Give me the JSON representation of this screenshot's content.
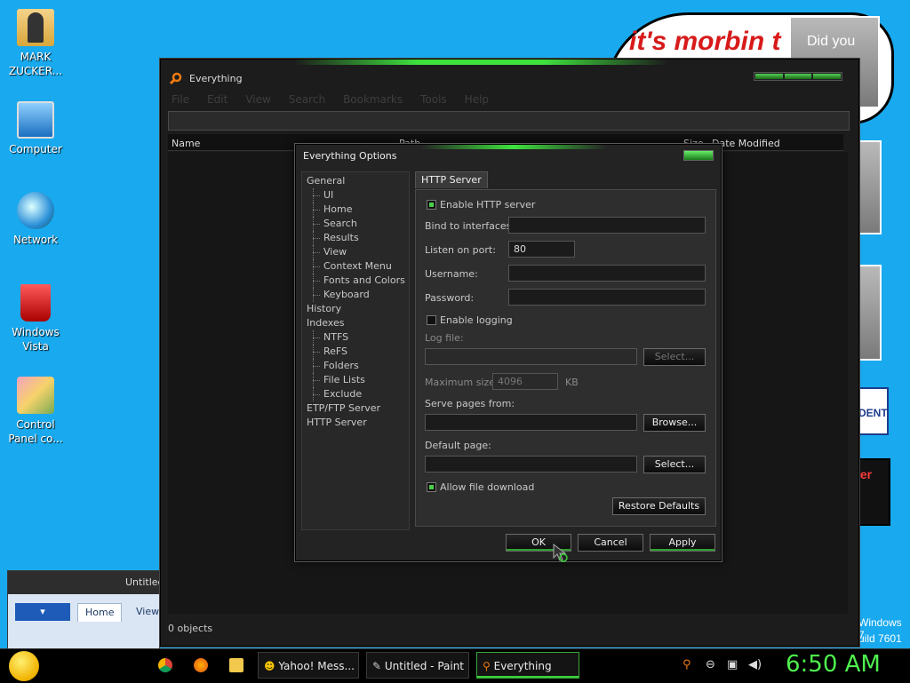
{
  "desktop": {
    "icons": [
      {
        "label": "MARK ZUCKER...",
        "icon": "folder-person-icon"
      },
      {
        "label": "Computer",
        "icon": "computer-icon"
      },
      {
        "label": "Network",
        "icon": "network-icon"
      },
      {
        "label": "Windows Vista",
        "icon": "recycle-bin-icon"
      },
      {
        "label": "Control Panel co...",
        "icon": "control-panel-icon"
      }
    ],
    "wallpaper_text": "it's morbin t",
    "photo_caption": "Did you",
    "dent_text": "DENT",
    "red_box_text": "ier",
    "watermark_line1": "Windows 7",
    "watermark_line2": "uild 7601"
  },
  "paint_window": {
    "title": "Untitled",
    "file_button": "▾",
    "tabs": [
      "Home",
      "View"
    ]
  },
  "everything_window": {
    "title": "Everything",
    "menu": [
      "File",
      "Edit",
      "View",
      "Search",
      "Bookmarks",
      "Tools",
      "Help"
    ],
    "columns": [
      "Name",
      "Path",
      "Size",
      "Date Modified"
    ],
    "status": "0 objects"
  },
  "options_dialog": {
    "title": "Everything Options",
    "tree": [
      {
        "label": "General",
        "level": 1
      },
      {
        "label": "UI",
        "level": 2
      },
      {
        "label": "Home",
        "level": 2
      },
      {
        "label": "Search",
        "level": 2
      },
      {
        "label": "Results",
        "level": 2
      },
      {
        "label": "View",
        "level": 2
      },
      {
        "label": "Context Menu",
        "level": 2
      },
      {
        "label": "Fonts and Colors",
        "level": 2
      },
      {
        "label": "Keyboard",
        "level": 2
      },
      {
        "label": "History",
        "level": 1
      },
      {
        "label": "Indexes",
        "level": 1
      },
      {
        "label": "NTFS",
        "level": 2
      },
      {
        "label": "ReFS",
        "level": 2
      },
      {
        "label": "Folders",
        "level": 2
      },
      {
        "label": "File Lists",
        "level": 2
      },
      {
        "label": "Exclude",
        "level": 2
      },
      {
        "label": "ETP/FTP Server",
        "level": 1
      },
      {
        "label": "HTTP Server",
        "level": 1
      }
    ],
    "tab": "HTTP Server",
    "enable_http": {
      "label": "Enable HTTP server",
      "checked": true
    },
    "bind_label": "Bind to interfaces:",
    "bind_value": "",
    "port_label": "Listen on port:",
    "port_value": "80",
    "username_label": "Username:",
    "username_value": "",
    "password_label": "Password:",
    "password_value": "",
    "enable_logging": {
      "label": "Enable logging",
      "checked": false
    },
    "log_file_label": "Log file:",
    "log_file_value": "",
    "select_button": "Select...",
    "max_size_label": "Maximum size:",
    "max_size_value": "4096",
    "max_size_unit": "KB",
    "serve_label": "Serve pages from:",
    "serve_value": "",
    "browse_button": "Browse...",
    "default_page_label": "Default page:",
    "default_page_value": "",
    "select_button2": "Select...",
    "allow_download": {
      "label": "Allow file download",
      "checked": true
    },
    "restore_button": "Restore Defaults",
    "ok_button": "OK",
    "cancel_button": "Cancel",
    "apply_button": "Apply"
  },
  "taskbar": {
    "tasks": [
      {
        "label": "Yahoo! Mess...",
        "icon": "yahoo-messenger-icon"
      },
      {
        "label": "Untitled - Paint",
        "icon": "paint-icon"
      },
      {
        "label": "Everything",
        "icon": "everything-search-icon"
      }
    ],
    "clock": "6:50 AM",
    "accent": "#3ad03a"
  }
}
